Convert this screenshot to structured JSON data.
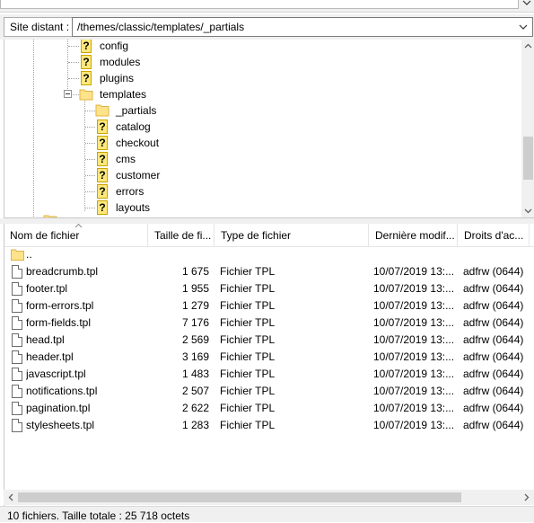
{
  "path_bar": {
    "label": "Site distant :",
    "value": "/themes/classic/templates/_partials"
  },
  "tree": {
    "items": [
      {
        "label": "config",
        "icon": "unknown-folder-icon"
      },
      {
        "label": "modules",
        "icon": "unknown-folder-icon"
      },
      {
        "label": "plugins",
        "icon": "unknown-folder-icon"
      },
      {
        "label": "templates",
        "icon": "folder-icon",
        "expanded": true
      },
      {
        "label": "_partials",
        "icon": "folder-icon",
        "selected": true
      },
      {
        "label": "catalog",
        "icon": "unknown-folder-icon"
      },
      {
        "label": "checkout",
        "icon": "unknown-folder-icon"
      },
      {
        "label": "cms",
        "icon": "unknown-folder-icon"
      },
      {
        "label": "customer",
        "icon": "unknown-folder-icon"
      },
      {
        "label": "errors",
        "icon": "unknown-folder-icon"
      },
      {
        "label": "layouts",
        "icon": "unknown-folder-icon"
      }
    ]
  },
  "file_list": {
    "columns": [
      {
        "label": "Nom de fichier"
      },
      {
        "label": "Taille de fi..."
      },
      {
        "label": "Type de fichier"
      },
      {
        "label": "Dernière modif..."
      },
      {
        "label": "Droits d'ac..."
      }
    ],
    "parent_label": "..",
    "rows": [
      {
        "name": "breadcrumb.tpl",
        "size": "1 675",
        "type": "Fichier TPL",
        "modified": "10/07/2019 13:...",
        "perms": "adfrw (0644)"
      },
      {
        "name": "footer.tpl",
        "size": "1 955",
        "type": "Fichier TPL",
        "modified": "10/07/2019 13:...",
        "perms": "adfrw (0644)"
      },
      {
        "name": "form-errors.tpl",
        "size": "1 279",
        "type": "Fichier TPL",
        "modified": "10/07/2019 13:...",
        "perms": "adfrw (0644)"
      },
      {
        "name": "form-fields.tpl",
        "size": "7 176",
        "type": "Fichier TPL",
        "modified": "10/07/2019 13:...",
        "perms": "adfrw (0644)"
      },
      {
        "name": "head.tpl",
        "size": "2 569",
        "type": "Fichier TPL",
        "modified": "10/07/2019 13:...",
        "perms": "adfrw (0644)"
      },
      {
        "name": "header.tpl",
        "size": "3 169",
        "type": "Fichier TPL",
        "modified": "10/07/2019 13:...",
        "perms": "adfrw (0644)"
      },
      {
        "name": "javascript.tpl",
        "size": "1 483",
        "type": "Fichier TPL",
        "modified": "10/07/2019 13:...",
        "perms": "adfrw (0644)"
      },
      {
        "name": "notifications.tpl",
        "size": "2 507",
        "type": "Fichier TPL",
        "modified": "10/07/2019 13:...",
        "perms": "adfrw (0644)"
      },
      {
        "name": "pagination.tpl",
        "size": "2 622",
        "type": "Fichier TPL",
        "modified": "10/07/2019 13:...",
        "perms": "adfrw (0644)"
      },
      {
        "name": "stylesheets.tpl",
        "size": "1 283",
        "type": "Fichier TPL",
        "modified": "10/07/2019 13:...",
        "perms": "adfrw (0644)"
      }
    ]
  },
  "status": {
    "text": "10 fichiers. Taille totale : 25 718 octets"
  },
  "colors": {
    "folder": "#ffe38a",
    "folder_edge": "#dcb441",
    "unknown_page": "#ffe87a",
    "panel_bg": "#f0f0f0",
    "scroll_thumb": "#cdcdcd"
  }
}
